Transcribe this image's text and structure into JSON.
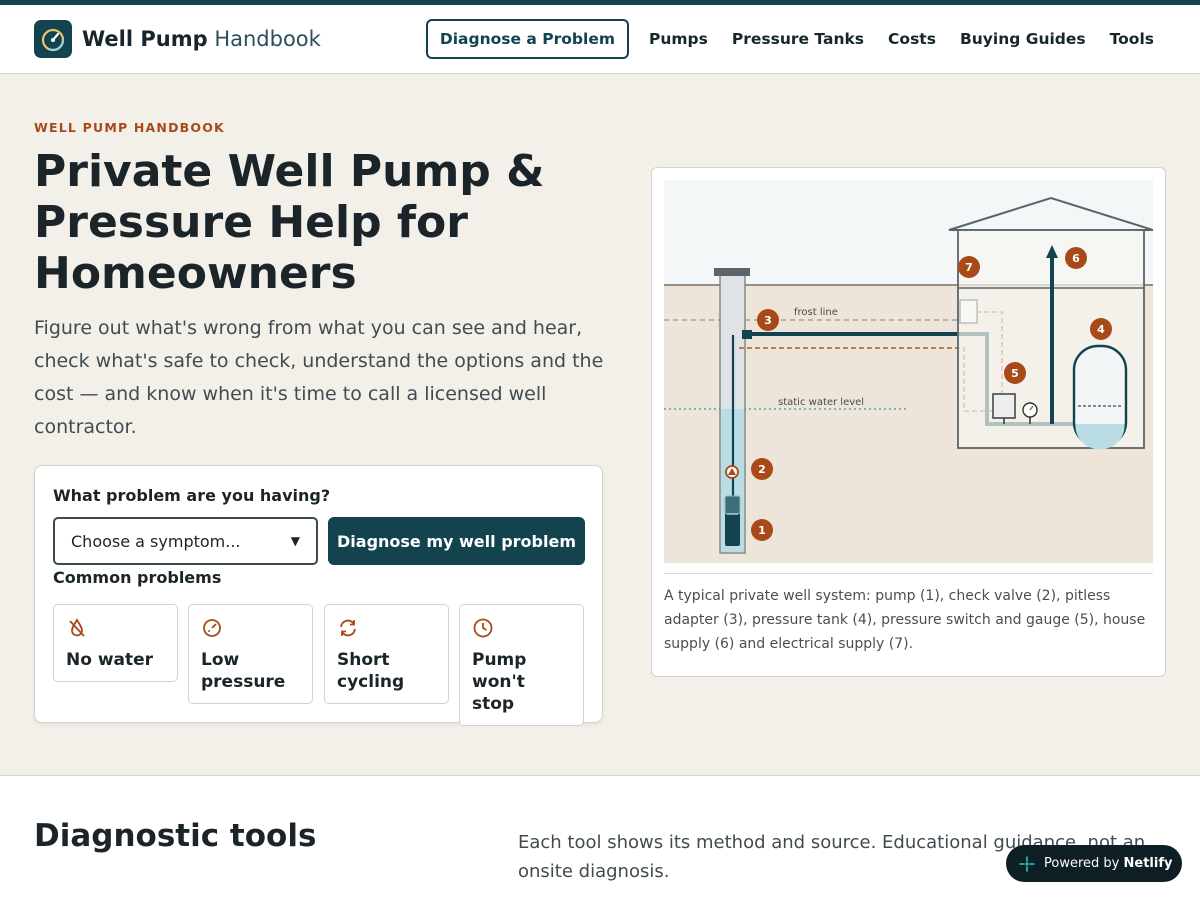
{
  "header": {
    "brand_bold": "Well Pump",
    "brand_light": "Handbook",
    "cta_label": "Diagnose a Problem",
    "nav": [
      "Pumps",
      "Pressure Tanks",
      "Costs",
      "Buying Guides",
      "Tools"
    ]
  },
  "hero": {
    "eyebrow": "WELL PUMP HANDBOOK",
    "title": "Private Well Pump & Pressure Help for Homeowners",
    "lead": "Figure out what's wrong from what you can see and hear, check what's safe to check, understand the options and the cost — and know when it's time to call a licensed well contractor."
  },
  "diagnose": {
    "question": "What problem are you having?",
    "select_value": "Choose a symptom...",
    "button_label": "Diagnose my well problem",
    "common_label": "Common problems",
    "problems": [
      {
        "label": "No water",
        "icon": "no-water-icon"
      },
      {
        "label": "Low pressure",
        "icon": "gauge-icon"
      },
      {
        "label": "Short cycling",
        "icon": "cycle-icon"
      },
      {
        "label": "Pump won't stop",
        "icon": "clock-icon"
      }
    ]
  },
  "figure": {
    "frost_line": "frost line",
    "static_level": "static water level",
    "markers": [
      "1",
      "2",
      "3",
      "4",
      "5",
      "6",
      "7"
    ],
    "caption": "A typical private well system: pump (1), check valve (2), pitless adapter (3), pressure tank (4), pressure switch and gauge (5), house supply (6) and electrical supply (7)."
  },
  "tools": {
    "title": "Diagnostic tools",
    "description": "Each tool shows its method and source. Educational guidance, not an onsite diagnosis."
  },
  "badge": {
    "prefix": "Powered by",
    "brand": "Netlify"
  },
  "colors": {
    "primary": "#12434f",
    "accent": "#a84a18",
    "hero_bg": "#f3f0ea"
  }
}
